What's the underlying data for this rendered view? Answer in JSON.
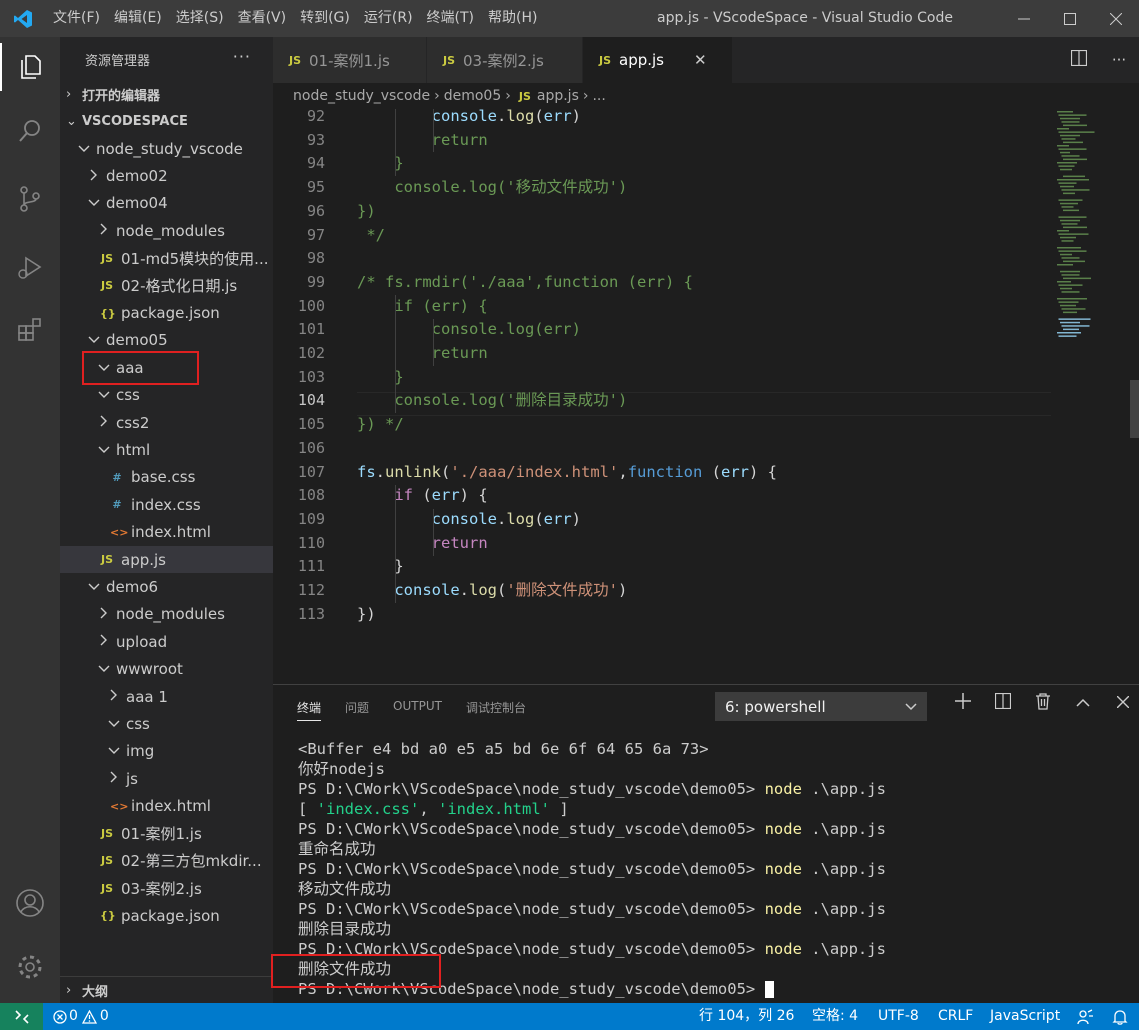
{
  "titlebar": {
    "menu": [
      "文件(F)",
      "编辑(E)",
      "选择(S)",
      "查看(V)",
      "转到(G)",
      "运行(R)",
      "终端(T)",
      "帮助(H)"
    ],
    "title": "app.js - VScodeSpace - Visual Studio Code"
  },
  "sidebar": {
    "header": "资源管理器",
    "open_editors": "打开的编辑器",
    "workspace": "VSCODESPACE",
    "outline": "大纲",
    "tree": [
      {
        "label": "node_study_vscode",
        "type": "folder-open",
        "depth": 0
      },
      {
        "label": "demo02",
        "type": "folder",
        "depth": 1
      },
      {
        "label": "demo04",
        "type": "folder-open",
        "depth": 1
      },
      {
        "label": "node_modules",
        "type": "folder",
        "depth": 2
      },
      {
        "label": "01-md5模块的使用...",
        "type": "js",
        "depth": 2
      },
      {
        "label": "02-格式化日期.js",
        "type": "js",
        "depth": 2
      },
      {
        "label": "package.json",
        "type": "json",
        "depth": 2
      },
      {
        "label": "demo05",
        "type": "folder-open",
        "depth": 1
      },
      {
        "label": "aaa",
        "type": "folder-open",
        "depth": 2
      },
      {
        "label": "css",
        "type": "folder-open",
        "depth": 2
      },
      {
        "label": "css2",
        "type": "folder",
        "depth": 2
      },
      {
        "label": "html",
        "type": "folder-open",
        "depth": 2
      },
      {
        "label": "base.css",
        "type": "css",
        "depth": 3
      },
      {
        "label": "index.css",
        "type": "css",
        "depth": 3
      },
      {
        "label": "index.html",
        "type": "html",
        "depth": 3
      },
      {
        "label": "app.js",
        "type": "js",
        "depth": 2,
        "selected": true
      },
      {
        "label": "demo6",
        "type": "folder-open",
        "depth": 1
      },
      {
        "label": "node_modules",
        "type": "folder",
        "depth": 2
      },
      {
        "label": "upload",
        "type": "folder",
        "depth": 2
      },
      {
        "label": "wwwroot",
        "type": "folder-open",
        "depth": 2
      },
      {
        "label": "aaa 1",
        "type": "folder",
        "depth": 3
      },
      {
        "label": "css",
        "type": "folder-open",
        "depth": 3
      },
      {
        "label": "img",
        "type": "folder-open",
        "depth": 3
      },
      {
        "label": "js",
        "type": "folder",
        "depth": 3
      },
      {
        "label": "index.html",
        "type": "html",
        "depth": 3
      },
      {
        "label": "01-案例1.js",
        "type": "js",
        "depth": 2
      },
      {
        "label": "02-第三方包mkdir...",
        "type": "js",
        "depth": 2
      },
      {
        "label": "03-案例2.js",
        "type": "js",
        "depth": 2
      },
      {
        "label": "package.json",
        "type": "json",
        "depth": 2
      }
    ]
  },
  "tabs": [
    {
      "label": "01-案例1.js",
      "active": false
    },
    {
      "label": "03-案例2.js",
      "active": false
    },
    {
      "label": "app.js",
      "active": true
    }
  ],
  "breadcrumb": [
    "node_study_vscode",
    "demo05",
    "app.js",
    "..."
  ],
  "editor": {
    "lines": [
      {
        "n": "92",
        "html": "        <span class=\"var\">console</span><span class=\"pl\">.</span><span class=\"fn\">log</span><span class=\"pl\">(</span><span class=\"var\">err</span><span class=\"pl\">)</span>",
        "cls": "cm"
      },
      {
        "n": "93",
        "text": "        return",
        "cls": "cm"
      },
      {
        "n": "94",
        "text": "    }",
        "cls": "cm"
      },
      {
        "n": "95",
        "text": "    console.log('移动文件成功')",
        "cls": "cm"
      },
      {
        "n": "96",
        "text": "})",
        "cls": "cm"
      },
      {
        "n": "97",
        "text": " */",
        "cls": "cm"
      },
      {
        "n": "98",
        "text": "",
        "cls": "cm"
      },
      {
        "n": "99",
        "text": "/* fs.rmdir('./aaa',function (err) {",
        "cls": "cm"
      },
      {
        "n": "100",
        "text": "    if (err) {",
        "cls": "cm"
      },
      {
        "n": "101",
        "text": "        console.log(err)",
        "cls": "cm"
      },
      {
        "n": "102",
        "text": "        return",
        "cls": "cm"
      },
      {
        "n": "103",
        "text": "    }",
        "cls": "cm"
      },
      {
        "n": "104",
        "text": "    console.log('删除目录成功')",
        "cls": "cm"
      },
      {
        "n": "105",
        "text": "}) */",
        "cls": "cm"
      },
      {
        "n": "106",
        "text": "",
        "cls": "cm"
      },
      {
        "n": "107",
        "text": "fs.unlink('./aaa/index.html',function (err) {",
        "cls": "code107"
      },
      {
        "n": "108",
        "text": "    if (err) {",
        "cls": "code108"
      },
      {
        "n": "109",
        "text": "        console.log(err)",
        "cls": "code109"
      },
      {
        "n": "110",
        "text": "        return",
        "cls": "code110"
      },
      {
        "n": "111",
        "text": "    }",
        "cls": "code111"
      },
      {
        "n": "112",
        "text": "    console.log('删除文件成功')",
        "cls": "code112"
      },
      {
        "n": "113",
        "text": "})",
        "cls": "code113"
      }
    ],
    "current_line": "104"
  },
  "panel": {
    "tabs": [
      "终端",
      "问题",
      "OUTPUT",
      "调试控制台"
    ],
    "active_tab": "终端",
    "terminal_select": "6: powershell",
    "terminal_lines": [
      "<Buffer e4 bd a0 e5 a5 bd 6e 6f 64 65 6a 73>",
      "你好nodejs",
      "PS D:\\CWork\\VScodeSpace\\node_study_vscode\\demo05> ",
      "[ 'index.css', 'index.html' ]",
      "PS D:\\CWork\\VScodeSpace\\node_study_vscode\\demo05> ",
      "重命名成功",
      "PS D:\\CWork\\VScodeSpace\\node_study_vscode\\demo05> ",
      "移动文件成功",
      "PS D:\\CWork\\VScodeSpace\\node_study_vscode\\demo05> ",
      "删除目录成功",
      "PS D:\\CWork\\VScodeSpace\\node_study_vscode\\demo05> ",
      "删除文件成功",
      "PS D:\\CWork\\VScodeSpace\\node_study_vscode\\demo05> "
    ],
    "cmd_node": "node",
    "cmd_arg": " .\\app.js"
  },
  "statusbar": {
    "errors": "0",
    "warnings": "0",
    "position": "行 104，列 26",
    "spaces": "空格: 4",
    "encoding": "UTF-8",
    "eol": "CRLF",
    "language": "JavaScript"
  },
  "colors": {
    "status_bg": "#007acc",
    "remote_bg": "#16825d",
    "comment": "#6a9955",
    "annotation_red": "#e02020"
  }
}
